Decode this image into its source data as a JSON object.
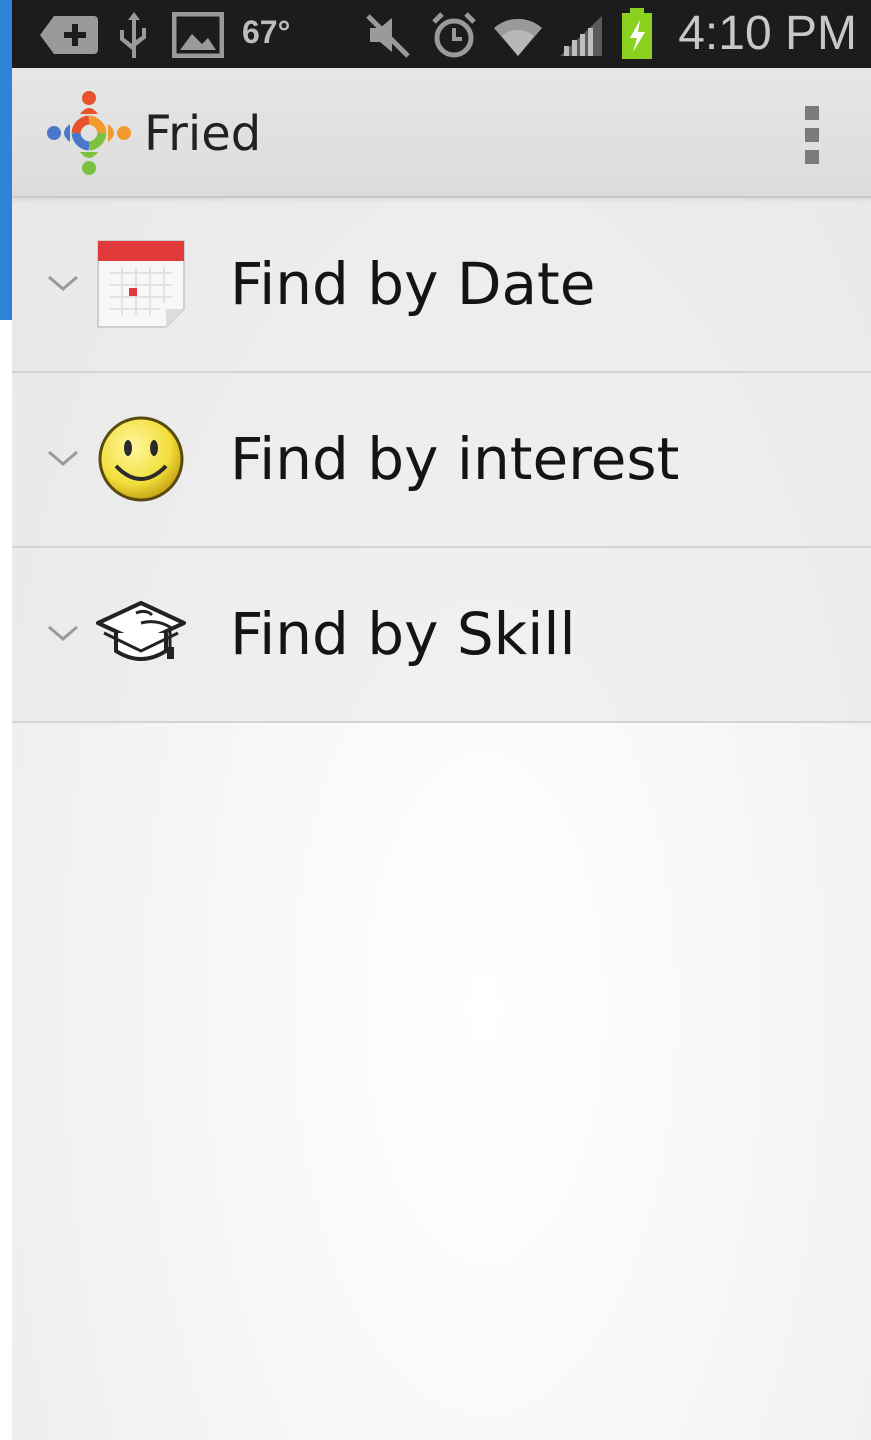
{
  "status_bar": {
    "temperature": "67°",
    "time": "4:10 PM",
    "icons": [
      "add-icon",
      "usb-icon",
      "image-icon",
      "mute-icon",
      "alarm-icon",
      "wifi-icon",
      "signal-icon",
      "battery-charging-icon"
    ]
  },
  "action_bar": {
    "title": "Fried",
    "logo_icon": "community-logo-icon",
    "overflow_icon": "overflow-menu-icon"
  },
  "list": {
    "items": [
      {
        "label": "Find by Date",
        "icon": "calendar-icon"
      },
      {
        "label": "Find by interest",
        "icon": "smiley-icon"
      },
      {
        "label": "Find by Skill",
        "icon": "graduation-cap-icon"
      }
    ]
  },
  "colors": {
    "status_bar_bg": "#1c1c1c",
    "action_bar_bg": "#e0e0e0",
    "battery_green": "#8ad11f",
    "calendar_red": "#e03a3a",
    "smiley_yellow": "#f2de3a",
    "side_strip_blue": "#2d83d8"
  }
}
